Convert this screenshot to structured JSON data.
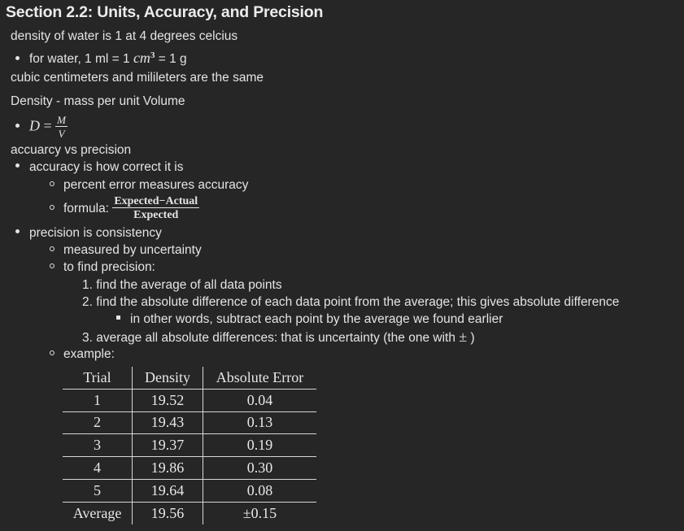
{
  "title": "Section 2.2: Units, Accuracy, and Precision",
  "notes": {
    "water_density": "density of water is 1 at 4 degrees celcius",
    "water_volume_prefix": "for water, 1 ml = 1 ",
    "water_volume_unit": "cm",
    "water_volume_exp": "3",
    "water_volume_suffix": " = 1 g",
    "cc_ml_same": "cubic centimeters and milileters are the same",
    "density_def": "Density - mass per unit Volume",
    "density_formula_lhs": "D",
    "density_formula_eq": " = ",
    "density_formula_num": "M",
    "density_formula_den": "V",
    "acc_vs_prec": "accuarcy vs precision",
    "accuracy_def": "accuracy is how correct it is",
    "percent_error": "percent error measures accuracy",
    "formula_label": "formula: ",
    "formula_num": "Expected−Actual",
    "formula_den": "Expected",
    "precision_def": "precision is consistency",
    "measured_by": "measured by uncertainty",
    "to_find": "to find precision:",
    "step1": "1. find the average of all data points",
    "step2": "2. find the absolute difference of each data point from the average; this gives absolute difference",
    "step2_sub": "in other words, subtract each point by the average we found earlier",
    "step3_prefix": "3. average all absolute differences: that is uncertainty (the one with ",
    "step3_symbol": "±",
    "step3_suffix": " )",
    "example": "example:"
  },
  "table": {
    "headers": [
      "Trial",
      "Density",
      "Absolute Error"
    ],
    "rows": [
      [
        "1",
        "19.52",
        "0.04"
      ],
      [
        "2",
        "19.43",
        "0.13"
      ],
      [
        "3",
        "19.37",
        "0.19"
      ],
      [
        "4",
        "19.86",
        "0.30"
      ],
      [
        "5",
        "19.64",
        "0.08"
      ],
      [
        "Average",
        "19.56",
        "±0.15"
      ]
    ]
  },
  "colors": {
    "background": "#262626",
    "text": "#e4e4e4",
    "rule": "#d6d6d6"
  }
}
